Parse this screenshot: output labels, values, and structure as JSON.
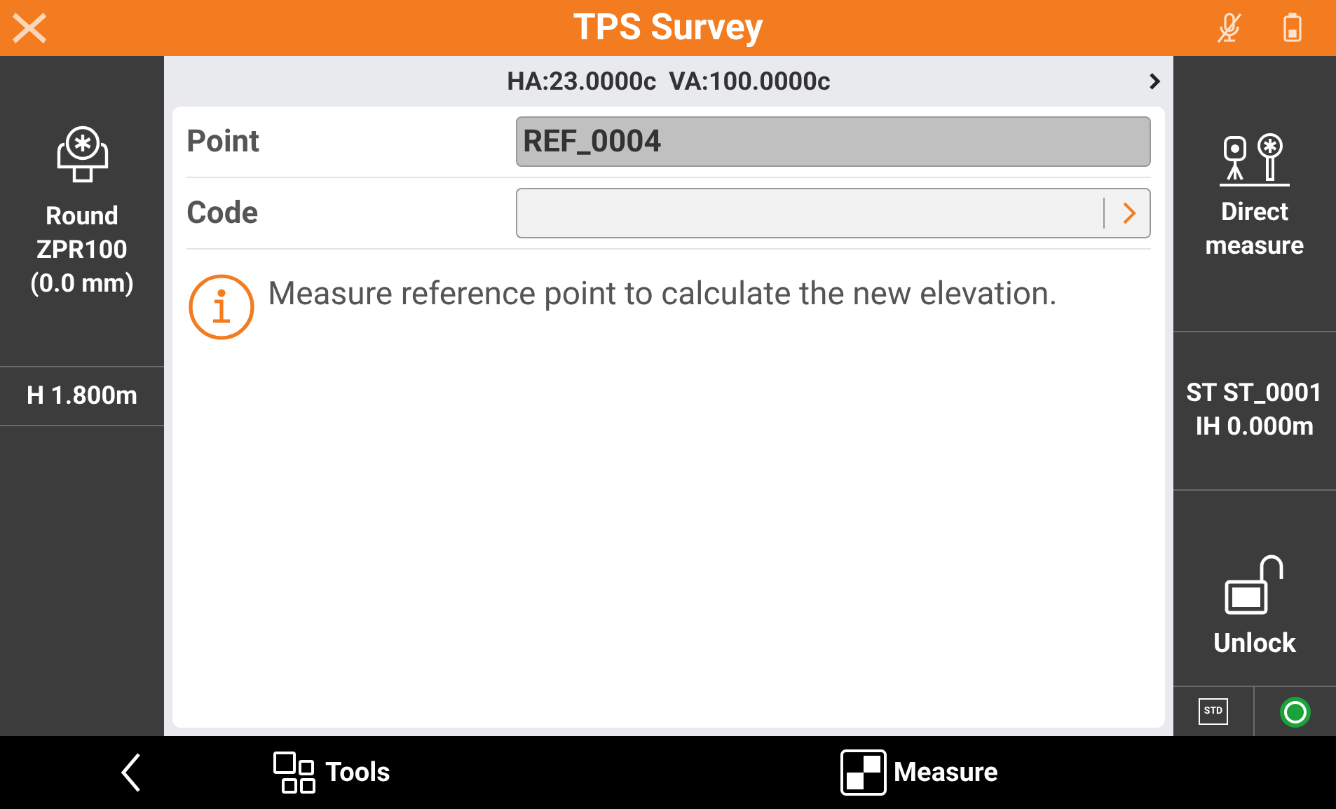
{
  "header": {
    "title": "TPS Survey"
  },
  "left_panel": {
    "prism_button": {
      "label": "Round\nZPR100\n(0.0 mm)"
    },
    "height": "H 1.800m"
  },
  "angles": "HA:23.0000c  VA:100.0000c",
  "form": {
    "fields": [
      {
        "label": "Point",
        "value": "REF_0004",
        "kind": "text",
        "disabled": true
      },
      {
        "label": "Code",
        "kind": "picker",
        "disabled": false
      }
    ]
  },
  "message": "Measure reference point to calculate the new elevation.",
  "right_panel": {
    "measure_button": {
      "label": "Direct\nmeasure"
    },
    "station": "ST ST_0001\nIH 0.000m",
    "unlock_button": {
      "label": "Unlock"
    },
    "mode": "STD"
  },
  "bottom_bar": {
    "tools": "Tools",
    "measure": "Measure"
  }
}
